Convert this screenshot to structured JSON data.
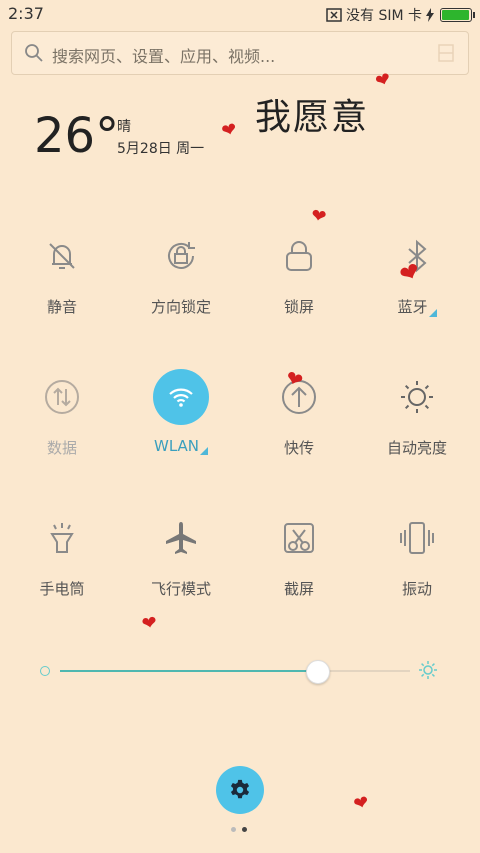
{
  "status": {
    "time": "2:37",
    "sim_text": "没有 SIM 卡"
  },
  "search": {
    "placeholder": "搜索网页、设置、应用、视频..."
  },
  "weather": {
    "temperature": "26°",
    "condition": "晴",
    "date": "5月28日 周一"
  },
  "slogan": "我愿意",
  "tiles": [
    {
      "label": "静音"
    },
    {
      "label": "方向锁定"
    },
    {
      "label": "锁屏"
    },
    {
      "label": "蓝牙"
    },
    {
      "label": "数据"
    },
    {
      "label": "WLAN"
    },
    {
      "label": "快传"
    },
    {
      "label": "自动亮度"
    },
    {
      "label": "手电筒"
    },
    {
      "label": "飞行模式"
    },
    {
      "label": "截屏"
    },
    {
      "label": "振动"
    }
  ],
  "brightness": {
    "level": 0.75
  },
  "colors": {
    "background": "#fbe8cf",
    "accent": "#4fc3e8",
    "slider": "#4eb7b0",
    "heart": "#d42020"
  },
  "pager": {
    "pages": 2,
    "current": 2
  }
}
